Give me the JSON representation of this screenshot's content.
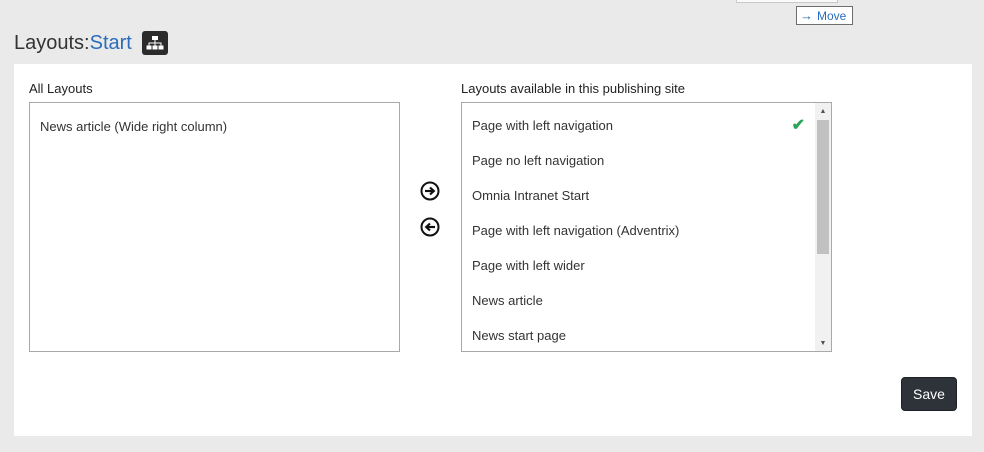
{
  "tooltip": {
    "label": "Move"
  },
  "header": {
    "prefix": "Layouts:",
    "link": "Start",
    "icon": "sitemap-icon"
  },
  "left_list": {
    "label": "All Layouts",
    "items": [
      "News article (Wide right column)"
    ]
  },
  "right_list": {
    "label": "Layouts available in this publishing site",
    "items": [
      {
        "text": "Page with left navigation",
        "checked": true
      },
      {
        "text": "Page no left navigation"
      },
      {
        "text": "Omnia Intranet Start"
      },
      {
        "text": "Page with left navigation (Adventrix)"
      },
      {
        "text": "Page with left wider"
      },
      {
        "text": "News article"
      },
      {
        "text": "News start page"
      }
    ]
  },
  "actions": {
    "move_right_icon": "arrow-right-circle-icon",
    "move_left_icon": "arrow-left-circle-icon",
    "save": "Save"
  },
  "colors": {
    "link": "#2a6ebb",
    "check": "#2aa55a",
    "save_bg": "#2d3338"
  }
}
